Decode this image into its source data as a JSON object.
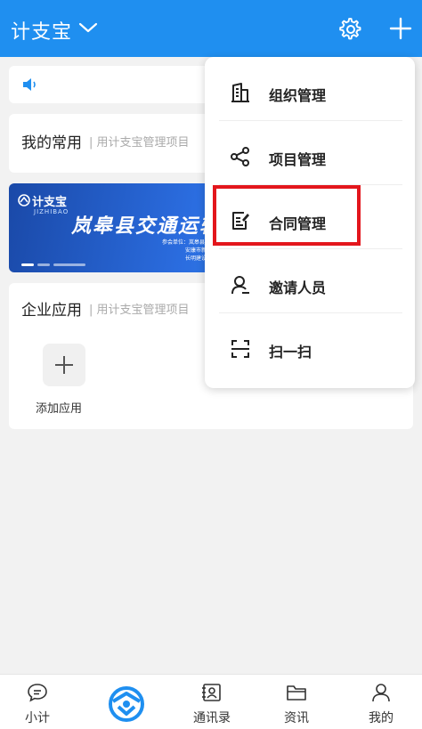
{
  "header": {
    "title": "计支宝",
    "icons": {
      "dropdown": "chevron-down-icon",
      "settings": "gear-icon",
      "add": "plus-icon"
    }
  },
  "announcement": {
    "icon": "speaker-icon"
  },
  "common": {
    "title": "我的常用",
    "subtitle": "| 用计支宝管理项目"
  },
  "banner": {
    "logo": "计支宝",
    "logo_sub": "JIZHIBAO",
    "headline": "岚皋县交通运输",
    "info_lines": [
      "参会单位：岚皋县交通",
      "安康市新",
      "长明建设集"
    ]
  },
  "enterprise": {
    "title": "企业应用",
    "subtitle": "| 用计支宝管理项目",
    "add_label": "添加应用"
  },
  "menu": {
    "items": [
      {
        "label": "组织管理",
        "icon": "building-icon"
      },
      {
        "label": "项目管理",
        "icon": "share-icon"
      },
      {
        "label": "合同管理",
        "icon": "contract-edit-icon",
        "highlighted": true
      },
      {
        "label": "邀请人员",
        "icon": "invite-user-icon"
      },
      {
        "label": "扫一扫",
        "icon": "scan-icon"
      }
    ],
    "highlight_color": "#e3161c"
  },
  "tabbar": {
    "tabs": [
      {
        "label": "小计",
        "icon": "chat-bubble-icon"
      },
      {
        "label": "",
        "icon": "jizhibao-logo-icon"
      },
      {
        "label": "通讯录",
        "icon": "contacts-icon"
      },
      {
        "label": "资讯",
        "icon": "news-folder-icon"
      },
      {
        "label": "我的",
        "icon": "profile-icon"
      }
    ]
  },
  "colors": {
    "primary": "#1f8ff0",
    "background": "#f2f2f2"
  }
}
